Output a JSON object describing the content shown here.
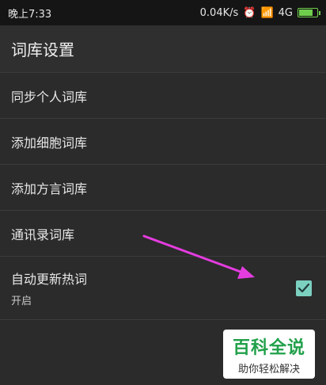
{
  "status_bar": {
    "time": "晚上7:33",
    "speed": "0.04K/s",
    "network": "4G",
    "accent": "#6fcf4d"
  },
  "app_bar": {
    "title": "词库设置"
  },
  "items": [
    {
      "label": "同步个人词库"
    },
    {
      "label": "添加细胞词库"
    },
    {
      "label": "添加方言词库"
    },
    {
      "label": "通讯录词库"
    }
  ],
  "auto_update": {
    "label": "自动更新热词",
    "status": "开启",
    "checked": true,
    "check_color": "#7cd0c0"
  },
  "annotation": {
    "arrow_color": "#e53ce0"
  },
  "watermark": {
    "title": "百科全说",
    "subtitle": "助你轻松解决"
  }
}
